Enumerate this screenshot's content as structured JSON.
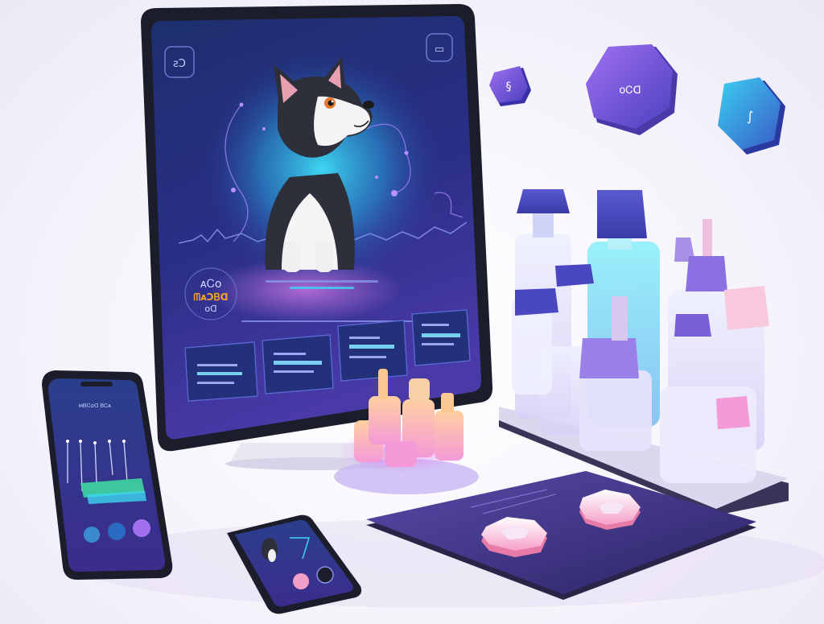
{
  "colors": {
    "background": "#f4f2fa",
    "screen_dark": "#1f2a66",
    "screen_mid": "#3a3fa8",
    "screen_glow": "#2fc3e6",
    "accent_purple": "#8a5cf0",
    "accent_pink": "#f59ad8",
    "accent_cyan": "#3fd6f0",
    "accent_orange": "#f0a030",
    "frame": "#1b1d2b"
  },
  "monitor": {
    "badge_left": "ƨƆ",
    "badge_right": "▭",
    "score_top": "ᴀᏟᴏ",
    "score_main": "ᗰᴀƆᏴᗡ",
    "score_bottom": "ᴏᗡ",
    "dog_character": "husky-puppy-icon"
  },
  "floating_tiles": {
    "left_icon": "swirl-icon",
    "center_label": "ᴏᏟᗡ",
    "right_icon": "squiggle-icon"
  },
  "phone_large": {
    "header_label": "ᴍᏴᏟᴏᗡ ᏴᏟᴀ"
  },
  "icons": {
    "dog": "husky-puppy-icon",
    "tablet_button_left": "hexagon-button-icon",
    "tablet_button_right": "hexagon-button-icon"
  }
}
